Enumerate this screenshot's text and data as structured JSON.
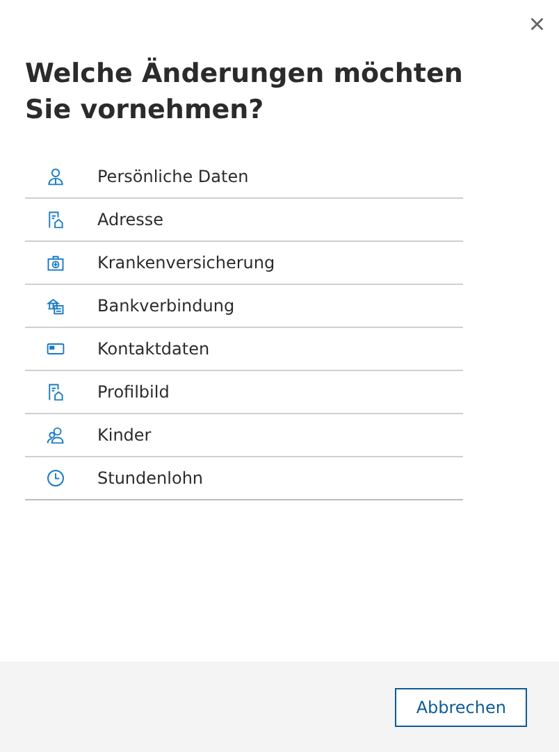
{
  "dialog": {
    "close": "×",
    "title": "Welche Änderungen möchten Sie vornehmen?",
    "items": [
      {
        "kind": "person",
        "label": "Persönliche Daten"
      },
      {
        "kind": "address",
        "label": "Adresse"
      },
      {
        "kind": "medical",
        "label": "Krankenversicherung"
      },
      {
        "kind": "bank",
        "label": "Bankverbindung"
      },
      {
        "kind": "card",
        "label": "Kontaktdaten"
      },
      {
        "kind": "address",
        "label": "Profilbild"
      },
      {
        "kind": "people",
        "label": "Kinder"
      },
      {
        "kind": "clock",
        "label": "Stundenlohn"
      }
    ],
    "buttons": [
      "Abbrechen"
    ]
  }
}
